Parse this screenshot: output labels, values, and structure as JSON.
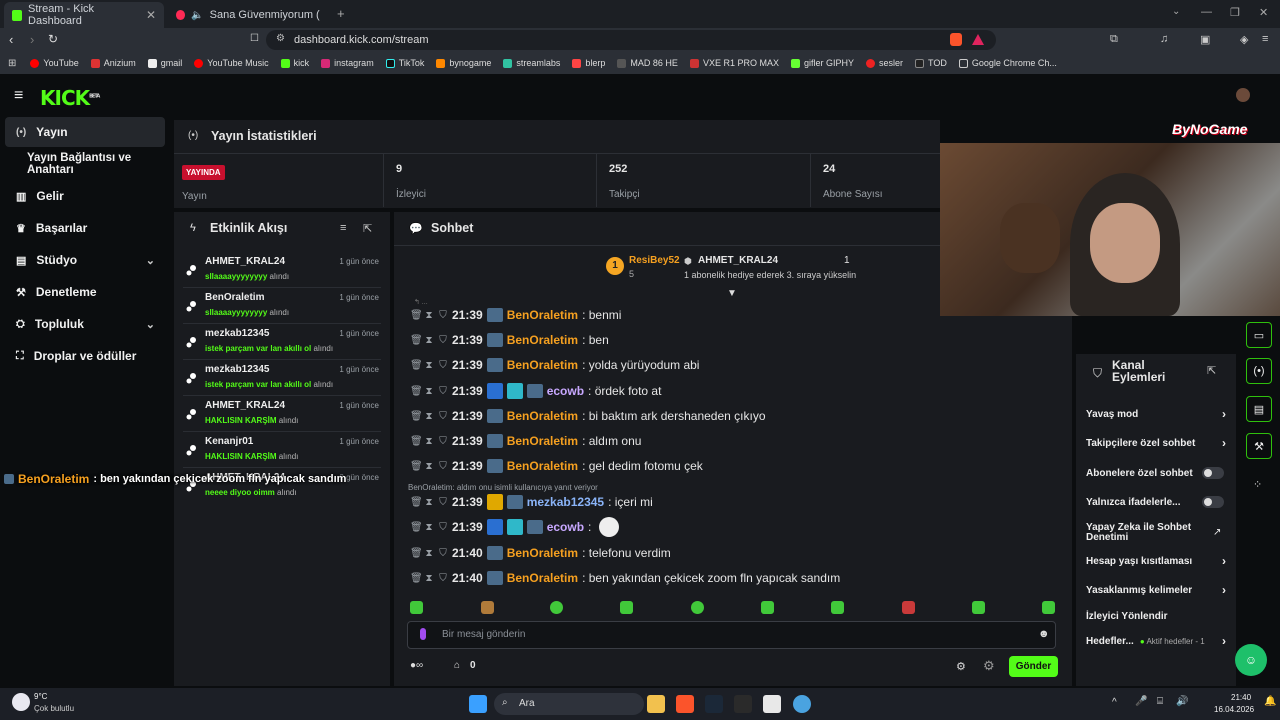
{
  "browser": {
    "tabs": [
      {
        "title": "Stream - Kick Dashboard",
        "active": true
      },
      {
        "title": "Sana Güvenmiyorum (Dedub Se",
        "active": false
      }
    ],
    "url": "dashboard.kick.com/stream",
    "bookmarks": [
      "YouTube",
      "Anizium",
      "gmail",
      "YouTube Music",
      "kick",
      "instagram",
      "TikTok",
      "bynogame",
      "streamlabs",
      "blerp",
      "MAD 86 HE",
      "VXE R1 PRO MAX",
      "gifler GIPHY",
      "sesler",
      "TOD",
      "Google Chrome Ch..."
    ]
  },
  "app": {
    "logo": "KICK",
    "logo_sup": "BETA",
    "brand": "ByNoGame"
  },
  "sidebar": {
    "items": [
      {
        "label": "Yayın",
        "icon": "broadcast-icon"
      },
      {
        "label": "Yayın Bağlantısı ve Anahtarı",
        "icon": ""
      },
      {
        "label": "Gelir",
        "icon": "chart-icon"
      },
      {
        "label": "Başarılar",
        "icon": "trophy-icon"
      },
      {
        "label": "Stüdyo",
        "icon": "studio-icon"
      },
      {
        "label": "Denetleme",
        "icon": "wrench-icon"
      },
      {
        "label": "Topluluk",
        "icon": "community-icon"
      },
      {
        "label": "Droplar ve ödüller",
        "icon": "drops-icon"
      }
    ]
  },
  "stats": {
    "title": "Yayın İstatistikleri",
    "live_badge": "YAYINDA",
    "live_label": "Yayın",
    "viewers_value": "9",
    "viewers_label": "İzleyici",
    "followers_value": "252",
    "followers_label": "Takipçi",
    "subs_value": "24",
    "subs_label": "Abone Sayısı"
  },
  "activity": {
    "title": "Etkinlik Akışı",
    "items": [
      {
        "name": "AHMET_KRAL24",
        "reward": "sllaaaayyyyyyyy",
        "suffix": "alındı",
        "time": "1 gün önce"
      },
      {
        "name": "BenOraletim",
        "reward": "sllaaaayyyyyyyy",
        "suffix": "alındı",
        "time": "1 gün önce"
      },
      {
        "name": "mezkab12345",
        "reward": "istek parçam var lan akıllı ol",
        "suffix": "alındı",
        "time": "1 gün önce"
      },
      {
        "name": "mezkab12345",
        "reward": "istek parçam var lan akıllı ol",
        "suffix": "alındı",
        "time": "1 gün önce"
      },
      {
        "name": "AHMET_KRAL24",
        "reward": "HAKLISIN KARŞİM",
        "suffix": "alındı",
        "time": "1 gün önce"
      },
      {
        "name": "Kenanjr01",
        "reward": "HAKLISIN KARŞİM",
        "suffix": "alındı",
        "time": "1 gün önce"
      },
      {
        "name": "AHMET_KRAL24",
        "reward": "neeee diyoo oimm",
        "suffix": "alındı",
        "time": "2 gün önce"
      }
    ]
  },
  "overlay_message": {
    "user": "BenOraletim",
    "text": ": ben yakından çekicek zoom fln yapıcak sandım"
  },
  "chat": {
    "title": "Sohbet",
    "leaderboard": {
      "first_user": "ResiBey52",
      "first_count": "5",
      "second_user": "AHMET_KRAL24",
      "second_count": "1",
      "hint": "1 abonelik hediye ederek 3. sıraya yükselin"
    },
    "reply_note": "BenOraletim: aldım onu isimli kullanıcıya yanıt veriyor",
    "messages": [
      {
        "time": "21:39",
        "user": "BenOraletim",
        "text": ": benmi",
        "color": "o"
      },
      {
        "time": "21:39",
        "user": "BenOraletim",
        "text": ": ben",
        "color": "o"
      },
      {
        "time": "21:39",
        "user": "BenOraletim",
        "text": ": yolda yürüyodum abi",
        "color": "o"
      },
      {
        "time": "21:39",
        "user": "ecowb",
        "text": ": ördek foto at",
        "color": "p"
      },
      {
        "time": "21:39",
        "user": "BenOraletim",
        "text": ": bi baktım ark dershaneden çıkıyo",
        "color": "o"
      },
      {
        "time": "21:39",
        "user": "BenOraletim",
        "text": ": aldım onu",
        "color": "o"
      },
      {
        "time": "21:39",
        "user": "BenOraletim",
        "text": ": gel dedim fotomu çek",
        "color": "o"
      },
      {
        "time": "21:39",
        "user": "mezkab12345",
        "text": ": içeri mi",
        "color": "b"
      },
      {
        "time": "21:39",
        "user": "ecowb",
        "text": ":",
        "color": "p"
      },
      {
        "time": "21:40",
        "user": "BenOraletim",
        "text": ": telefonu verdim",
        "color": "o"
      },
      {
        "time": "21:40",
        "user": "BenOraletim",
        "text": ": ben yakından çekicek zoom fln yapıcak sandım",
        "color": "o"
      }
    ],
    "input_placeholder": "Bir mesaj gönderin",
    "points": "0",
    "send_label": "Gönder"
  },
  "channel_actions": {
    "title": "Kanal Eylemleri",
    "items": [
      {
        "label": "Yavaş mod",
        "control": "chevron"
      },
      {
        "label": "Takipçilere özel sohbet",
        "control": "chevron"
      },
      {
        "label": "Abonelere özel sohbet",
        "control": "toggle"
      },
      {
        "label": "Yalnızca ifadelerle...",
        "control": "toggle"
      },
      {
        "label": "Yapay Zeka ile Sohbet Denetimi",
        "control": "external"
      },
      {
        "label": "Hesap yaşı kısıtlaması",
        "control": "chevron"
      },
      {
        "label": "Yasaklanmış kelimeler",
        "control": "chevron"
      },
      {
        "label": "İzleyici Yönlendir",
        "control": "none"
      },
      {
        "label": "Hedefler...",
        "control": "chevron",
        "sub": "Aktif hedefler - 1"
      }
    ]
  },
  "taskbar": {
    "weather_temp": "9°C",
    "weather_desc": "Çok bulutlu",
    "search": "Ara",
    "time": "21:40",
    "date": "16.04.2026"
  },
  "colors": {
    "accent": "#53fc18",
    "orange": "#f5a020",
    "panel": "#191b1f"
  }
}
